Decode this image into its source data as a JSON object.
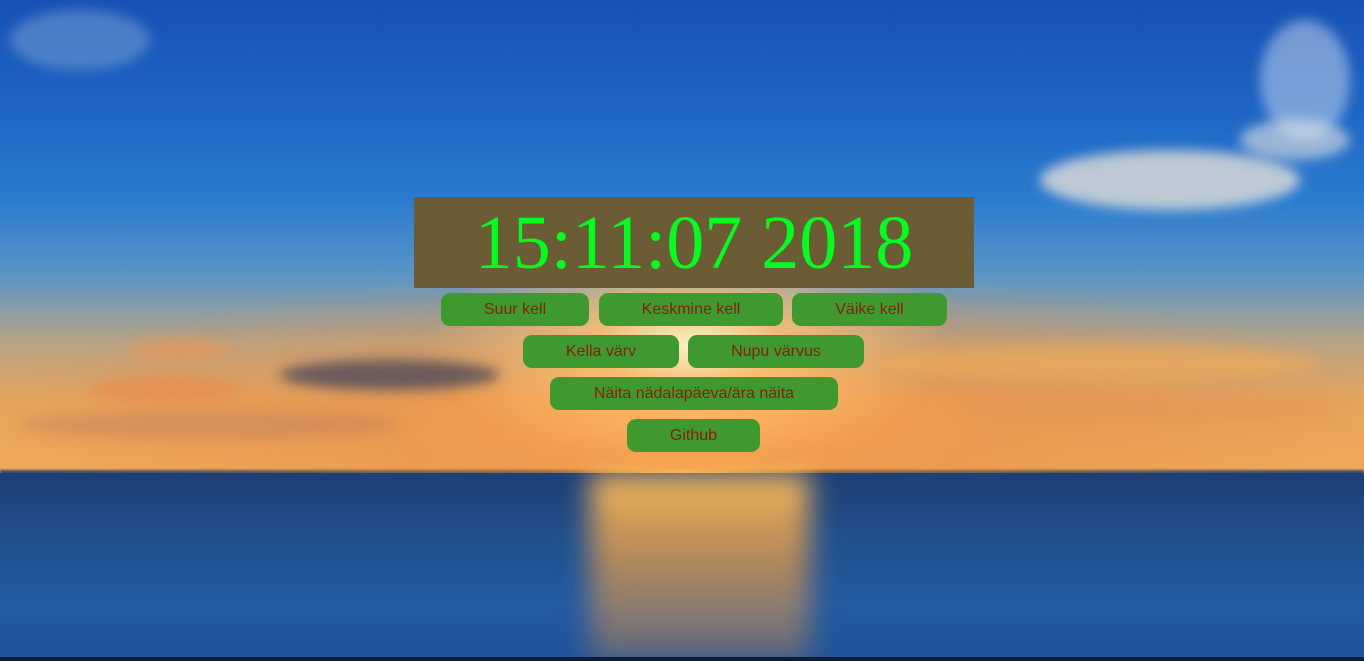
{
  "clock": {
    "time_text": "15:11:07 2018"
  },
  "buttons": {
    "large_clock": "Suur kell",
    "medium_clock": "Keskmine kell",
    "small_clock": "Väike kell",
    "clock_color": "Kella värv",
    "button_color": "Nupu värvus",
    "toggle_weekday": "Näita nädalapäeva/ära näita",
    "github": "Github"
  },
  "colors": {
    "clock_background": "#6b5c36",
    "clock_digits": "#00ff1e",
    "button_background": "#3e9a2f",
    "button_text": "#8a1d0c"
  }
}
